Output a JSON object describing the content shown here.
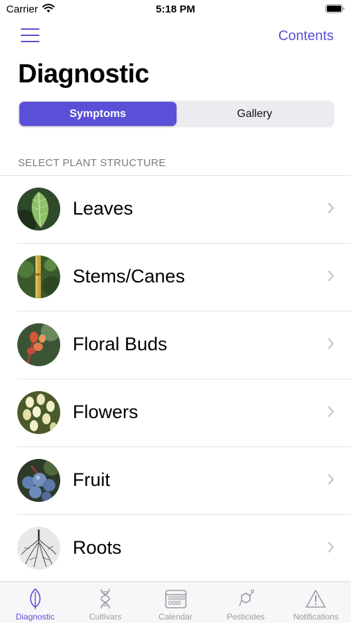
{
  "status_bar": {
    "carrier": "Carrier",
    "time": "5:18 PM"
  },
  "nav": {
    "contents_label": "Contents"
  },
  "page": {
    "title": "Diagnostic"
  },
  "segments": [
    {
      "label": "Symptoms",
      "active": true
    },
    {
      "label": "Gallery",
      "active": false
    }
  ],
  "section": {
    "header": "SELECT PLANT STRUCTURE"
  },
  "structures": [
    {
      "label": "Leaves",
      "icon": "leaf-photo"
    },
    {
      "label": "Stems/Canes",
      "icon": "stem-photo"
    },
    {
      "label": "Floral Buds",
      "icon": "bud-photo"
    },
    {
      "label": "Flowers",
      "icon": "flower-photo"
    },
    {
      "label": "Fruit",
      "icon": "fruit-photo"
    },
    {
      "label": "Roots",
      "icon": "root-photo"
    }
  ],
  "tabbar": [
    {
      "label": "Diagnostic",
      "icon": "leaf-icon",
      "active": true
    },
    {
      "label": "Cultivars",
      "icon": "dna-icon",
      "active": false
    },
    {
      "label": "Calendar",
      "icon": "calendar-icon",
      "active": false
    },
    {
      "label": "Pesticides",
      "icon": "molecule-icon",
      "active": false
    },
    {
      "label": "Notifications",
      "icon": "warning-icon",
      "active": false
    }
  ],
  "colors": {
    "accent": "#5a4fd6",
    "inactive_tab": "#9a9aa0"
  }
}
